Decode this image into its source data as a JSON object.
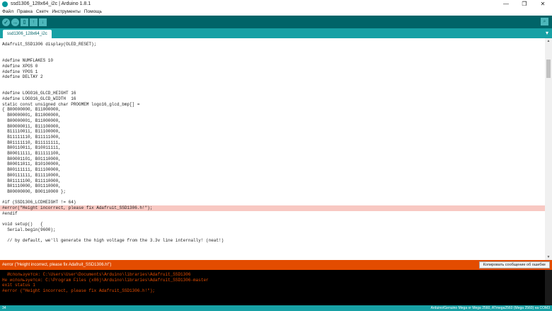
{
  "window": {
    "title": "ssd1306_128x64_i2c | Arduino 1.8.1",
    "minimize": "—",
    "maximize": "❐",
    "close": "✕"
  },
  "menu": [
    "Файл",
    "Правка",
    "Скетч",
    "Инструменты",
    "Помощь"
  ],
  "toolbar": {
    "verify": "✓",
    "upload": "→",
    "new": "▯",
    "open": "↑",
    "save": "↓",
    "serial_monitor": "⌕"
  },
  "tab": {
    "name": "ssd1306_128x64_i2c",
    "menu": "▾"
  },
  "code": [
    {
      "text": "Adafruit_SSD1306 display(OLED_RESET);",
      "hl": false
    },
    {
      "text": "",
      "hl": false
    },
    {
      "text": "",
      "hl": false
    },
    {
      "text": "#define NUMFLAKES 10",
      "hl": false
    },
    {
      "text": "#define XPOS 0",
      "hl": false
    },
    {
      "text": "#define YPOS 1",
      "hl": false
    },
    {
      "text": "#define DELTAY 2",
      "hl": false
    },
    {
      "text": "",
      "hl": false
    },
    {
      "text": "",
      "hl": false
    },
    {
      "text": "#define LOGO16_GLCD_HEIGHT 16",
      "hl": false
    },
    {
      "text": "#define LOGO16_GLCD_WIDTH  16",
      "hl": false
    },
    {
      "text": "static const unsigned char PROGMEM logo16_glcd_bmp[] =",
      "hl": false
    },
    {
      "text": "{ B00000000, B11000000,",
      "hl": false
    },
    {
      "text": "  B00000001, B11000000,",
      "hl": false
    },
    {
      "text": "  B00000001, B11000000,",
      "hl": false
    },
    {
      "text": "  B00000011, B11100000,",
      "hl": false
    },
    {
      "text": "  B11110011, B11100000,",
      "hl": false
    },
    {
      "text": "  B11111110, B11111000,",
      "hl": false
    },
    {
      "text": "  B01111110, B11111111,",
      "hl": false
    },
    {
      "text": "  B00110011, B10011111,",
      "hl": false
    },
    {
      "text": "  B00011111, B11111100,",
      "hl": false
    },
    {
      "text": "  B00001101, B01110000,",
      "hl": false
    },
    {
      "text": "  B00011011, B10100000,",
      "hl": false
    },
    {
      "text": "  B00111111, B11100000,",
      "hl": false
    },
    {
      "text": "  B00111111, B11110000,",
      "hl": false
    },
    {
      "text": "  B01111100, B11110000,",
      "hl": false
    },
    {
      "text": "  B01110000, B01110000,",
      "hl": false
    },
    {
      "text": "  B00000000, B00110000 };",
      "hl": false
    },
    {
      "text": "",
      "hl": false
    },
    {
      "text": "#if (SSD1306_LCDHEIGHT != 64)",
      "hl": false
    },
    {
      "text": "#error(\"Height incorrect, please fix Adafruit_SSD1306.h!\");",
      "hl": true
    },
    {
      "text": "#endif",
      "hl": false
    },
    {
      "text": "",
      "hl": false
    },
    {
      "text": "void setup()   {",
      "hl": false
    },
    {
      "text": "  Serial.begin(9600);",
      "hl": false
    },
    {
      "text": "",
      "hl": false
    },
    {
      "text": "  // by default, we'll generate the high voltage from the 3.3v line internally! (neat!)",
      "hl": false
    }
  ],
  "status": {
    "message": "#error (\"Height incorrect, please fix Adafruit_SSD1306.h!\")",
    "copy_button": "Копировать сообщение об ошибке"
  },
  "console": [
    "  Используется: C:\\Users\\User\\Documents\\Arduino\\libraries\\Adafruit_SSD1306",
    "Не используется: C:\\Program Files (x86)\\Arduino\\libraries\\Adafruit_SSD1306-master",
    "exit status 1",
    "#error (\"Height incorrect, please fix Adafruit_SSD1306.h!\");"
  ],
  "footer": {
    "line": "34",
    "board": "Arduino/Genuino Mega or Mega 2560, ATmega2560 (Mega 2560) на COM3"
  },
  "colors": {
    "toolbar": "#006468",
    "tabstrip": "#17a1a5",
    "error_bar": "#e34c00",
    "error_highlight": "#f8c8c2",
    "console_bg": "#000000"
  }
}
